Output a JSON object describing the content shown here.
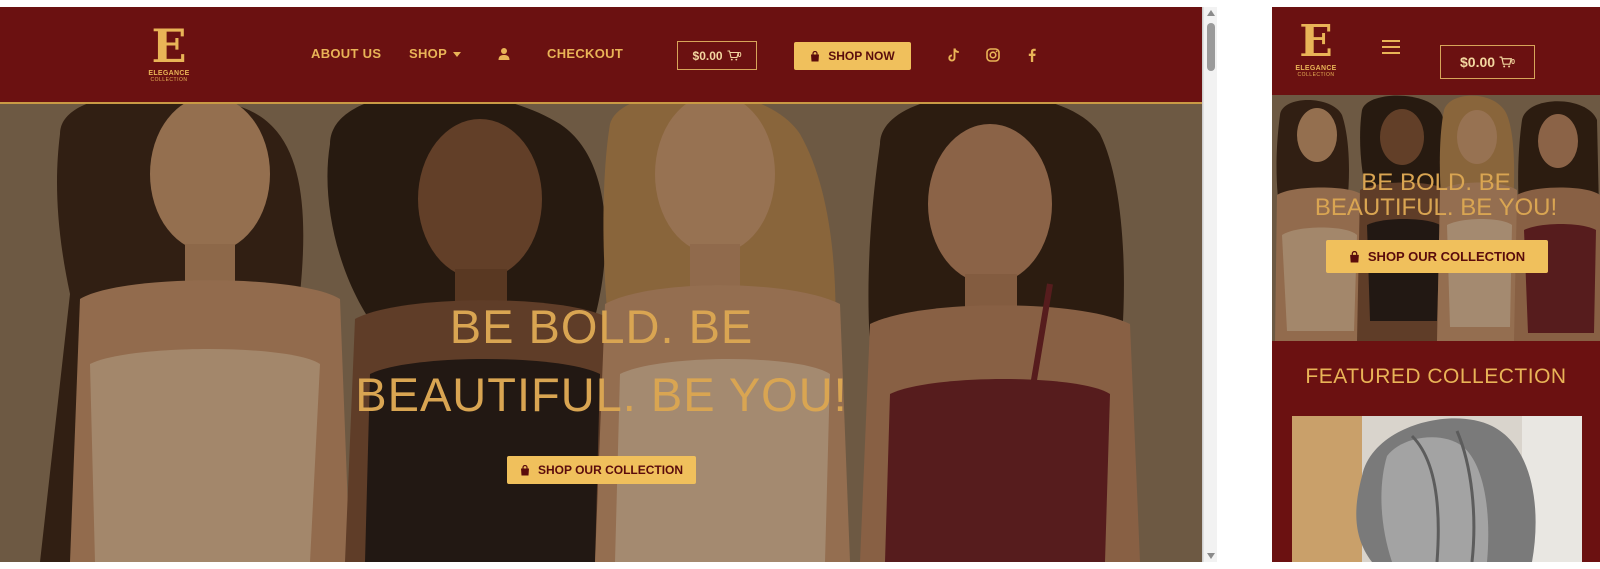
{
  "brand": {
    "logo_mark": "E",
    "logo_word": "ELEGANCE",
    "logo_sub": "COLLECTION"
  },
  "colors": {
    "header_bg": "#6b1111",
    "accent_gold": "#f0c05c",
    "headline_gold": "#d9a552"
  },
  "desktop": {
    "nav": {
      "about_label": "ABOUT US",
      "shop_label": "SHOP",
      "account_icon": "user-icon",
      "checkout_label": "CHECKOUT"
    },
    "cart": {
      "amount": "$0.00",
      "count": "0",
      "icon": "cart-icon"
    },
    "shop_now_label": "SHOP NOW",
    "social": [
      "tiktok-icon",
      "instagram-icon",
      "facebook-icon"
    ],
    "hero": {
      "headline_line1": "BE BOLD. BE",
      "headline_line2": "BEAUTIFUL. BE YOU!",
      "cta_label": "SHOP OUR COLLECTION"
    }
  },
  "mobile": {
    "menu_icon": "hamburger-icon",
    "cart": {
      "amount": "$0.00",
      "count": "0"
    },
    "hero": {
      "headline_line1": "BE BOLD. BE",
      "headline_line2": "BEAUTIFUL. BE YOU!",
      "cta_label": "SHOP OUR COLLECTION"
    },
    "featured_title": "FEATURED COLLECTION"
  }
}
